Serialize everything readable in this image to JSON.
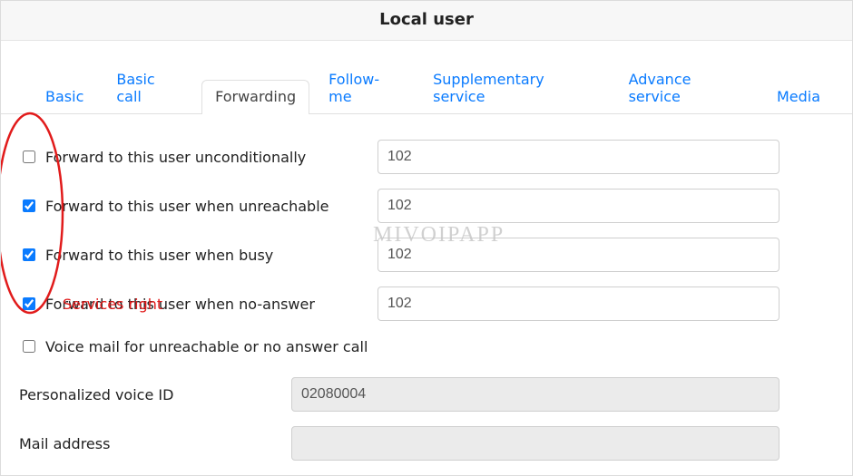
{
  "header": {
    "title": "Local user"
  },
  "tabs": [
    {
      "label": "Basic"
    },
    {
      "label": "Basic call"
    },
    {
      "label": "Forwarding"
    },
    {
      "label": "Follow-me"
    },
    {
      "label": "Supplementary service"
    },
    {
      "label": "Advance service"
    },
    {
      "label": "Media"
    }
  ],
  "active_tab": "Forwarding",
  "forwarding": {
    "rows": [
      {
        "label": "Forward to this user unconditionally",
        "value": "102",
        "checked": false
      },
      {
        "label": "Forward to this user when unreachable",
        "value": "102",
        "checked": true
      },
      {
        "label": "Forward to this user when busy",
        "value": "102",
        "checked": true
      },
      {
        "label": "Forward to this user when no-answer",
        "value": "102",
        "checked": true
      }
    ],
    "voice_mail": {
      "label": "Voice mail for unreachable or no answer call",
      "checked": false
    },
    "personal_voice_id": {
      "label": "Personalized voice ID",
      "value": "02080004"
    },
    "mail_address": {
      "label": "Mail address",
      "value": ""
    }
  },
  "annotation": {
    "label": "Services right"
  },
  "watermark": {
    "text": "MIVOIPAPP"
  }
}
